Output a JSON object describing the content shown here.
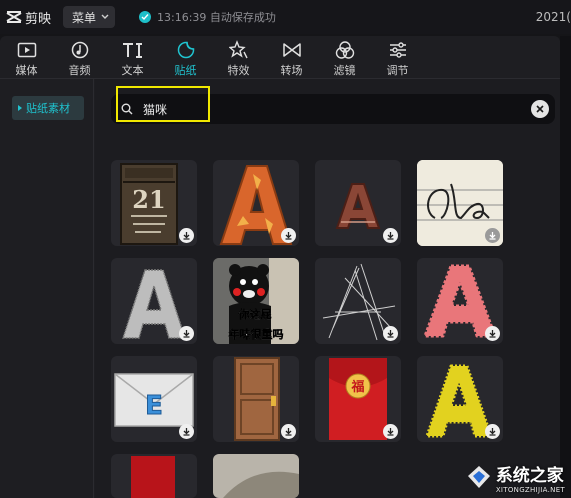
{
  "titlebar": {
    "app_name": "剪映",
    "menu_label": "菜单",
    "save_status": "13:16:39 自动保存成功",
    "date_partial": "2021("
  },
  "tabs": [
    {
      "label": "媒体",
      "icon": "media-icon"
    },
    {
      "label": "音频",
      "icon": "audio-icon"
    },
    {
      "label": "文本",
      "icon": "text-icon"
    },
    {
      "label": "贴纸",
      "icon": "sticker-icon",
      "active": true
    },
    {
      "label": "特效",
      "icon": "effects-icon"
    },
    {
      "label": "转场",
      "icon": "transition-icon"
    },
    {
      "label": "滤镜",
      "icon": "filter-icon"
    },
    {
      "label": "调节",
      "icon": "adjust-icon"
    }
  ],
  "sidebar": {
    "items": [
      {
        "label": "贴纸素材",
        "active": true
      }
    ]
  },
  "search": {
    "value": "猫咪"
  },
  "stickers": {
    "t2_text": "你这屁",
    "t2_text2": "年味很重吗",
    "t11_char": "福",
    "calendar_num": "21"
  },
  "watermark": {
    "title": "系统之家",
    "subtitle": "XITONGZHIJIA.NET"
  },
  "colors": {
    "accent": "#20c4d0",
    "highlight": "#f0e800",
    "background": "#1e1e22"
  }
}
